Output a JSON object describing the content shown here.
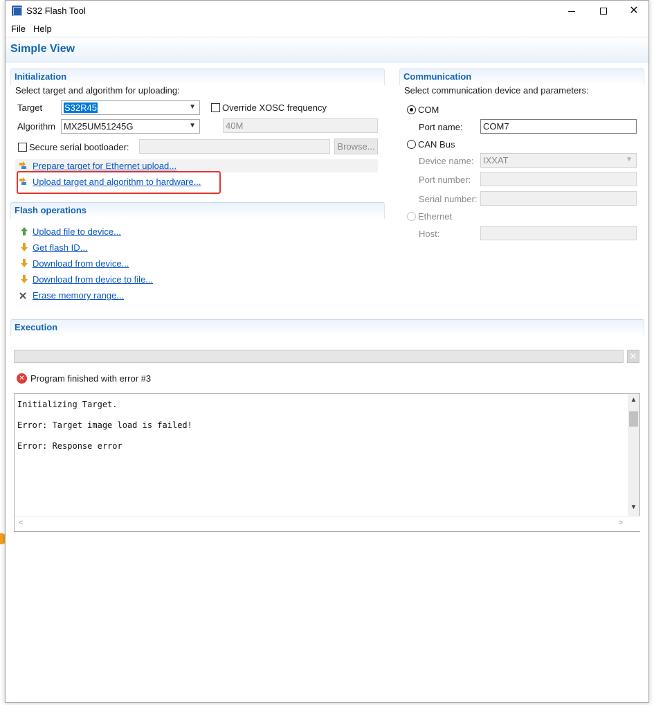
{
  "window": {
    "title": "S32 Flash Tool"
  },
  "menu": {
    "file": "File",
    "help": "Help"
  },
  "view_title": "Simple View",
  "initialization": {
    "title": "Initialization",
    "description": "Select target and algorithm for uploading:",
    "target_label": "Target",
    "target_value": "S32R45",
    "algorithm_label": "Algorithm",
    "algorithm_value": "MX25UM51245G",
    "override_xosc_label": "Override XOSC frequency",
    "override_xosc_checked": false,
    "xosc_value": "40M",
    "secure_bootloader_label": "Secure serial bootloader:",
    "secure_bootloader_checked": false,
    "secure_bootloader_path": "",
    "browse_label": "Browse...",
    "prepare_link": "Prepare target for Ethernet upload...",
    "upload_link": "Upload target and algorithm to hardware..."
  },
  "flash_operations": {
    "title": "Flash operations",
    "items": [
      {
        "label": "Upload file to device...",
        "icon": "arrow-up-icon"
      },
      {
        "label": "Get flash ID...",
        "icon": "arrow-down-icon"
      },
      {
        "label": "Download from device...",
        "icon": "arrow-down-icon"
      },
      {
        "label": "Download from device to file...",
        "icon": "arrow-down-icon"
      },
      {
        "label": "Erase memory range...",
        "icon": "erase-icon"
      }
    ]
  },
  "communication": {
    "title": "Communication",
    "description": "Select communication device and parameters:",
    "com_label": "COM",
    "com_selected": true,
    "port_name_label": "Port name:",
    "port_name_value": "COM7",
    "can_bus_label": "CAN Bus",
    "device_name_label": "Device name:",
    "device_name_value": "IXXAT",
    "port_number_label": "Port number:",
    "port_number_value": "",
    "serial_number_label": "Serial number:",
    "serial_number_value": "",
    "ethernet_label": "Ethernet",
    "host_label": "Host:",
    "host_value": ""
  },
  "execution": {
    "title": "Execution",
    "status": "Program finished with error #3",
    "log": [
      "Initializing Target.",
      "Error: Target image load is failed!",
      "Error: Response error"
    ]
  },
  "colors": {
    "accent": "#1464b4",
    "link": "#0a58c2",
    "error": "#d8403a",
    "highlight": "#e53232"
  }
}
